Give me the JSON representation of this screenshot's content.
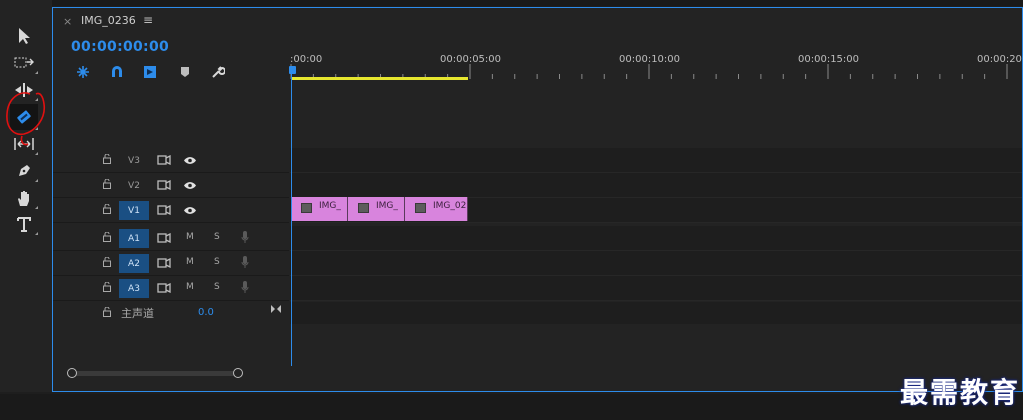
{
  "sequence": {
    "tab_close": "×",
    "tab_title": "IMG_0236",
    "tab_menu": "≡",
    "timecode": "00:00:00:00"
  },
  "ruler": {
    "labels": [
      ":00:00",
      "00:00:05:00",
      "00:00:10:00",
      "00:00:15:00",
      "00:00:20:"
    ]
  },
  "tools": [
    "selection-icon",
    "track-select-icon",
    "ripple-edit-icon",
    "razor-icon",
    "slip-icon",
    "pen-icon",
    "hand-icon",
    "type-icon"
  ],
  "controls": [
    "nest-icon",
    "snap-icon",
    "linked-selection-icon",
    "marker-icon",
    "wrench-icon"
  ],
  "video_tracks": [
    {
      "name": "V3"
    },
    {
      "name": "V2"
    },
    {
      "name": "V1"
    }
  ],
  "audio_tracks": [
    {
      "name": "A1",
      "mute": "M",
      "solo": "S"
    },
    {
      "name": "A2",
      "mute": "M",
      "solo": "S"
    },
    {
      "name": "A3",
      "mute": "M",
      "solo": "S"
    }
  ],
  "clips": [
    {
      "label": "IMG_"
    },
    {
      "label": "IMG_"
    },
    {
      "label": "IMG_02"
    }
  ],
  "master": {
    "label": "主声道",
    "value": "0.0"
  },
  "watermark": "最需教育",
  "colors": {
    "accent": "#2d8ceb",
    "clip": "#d884dd",
    "work_area": "#e7e72f",
    "annotation": "#e01010"
  }
}
